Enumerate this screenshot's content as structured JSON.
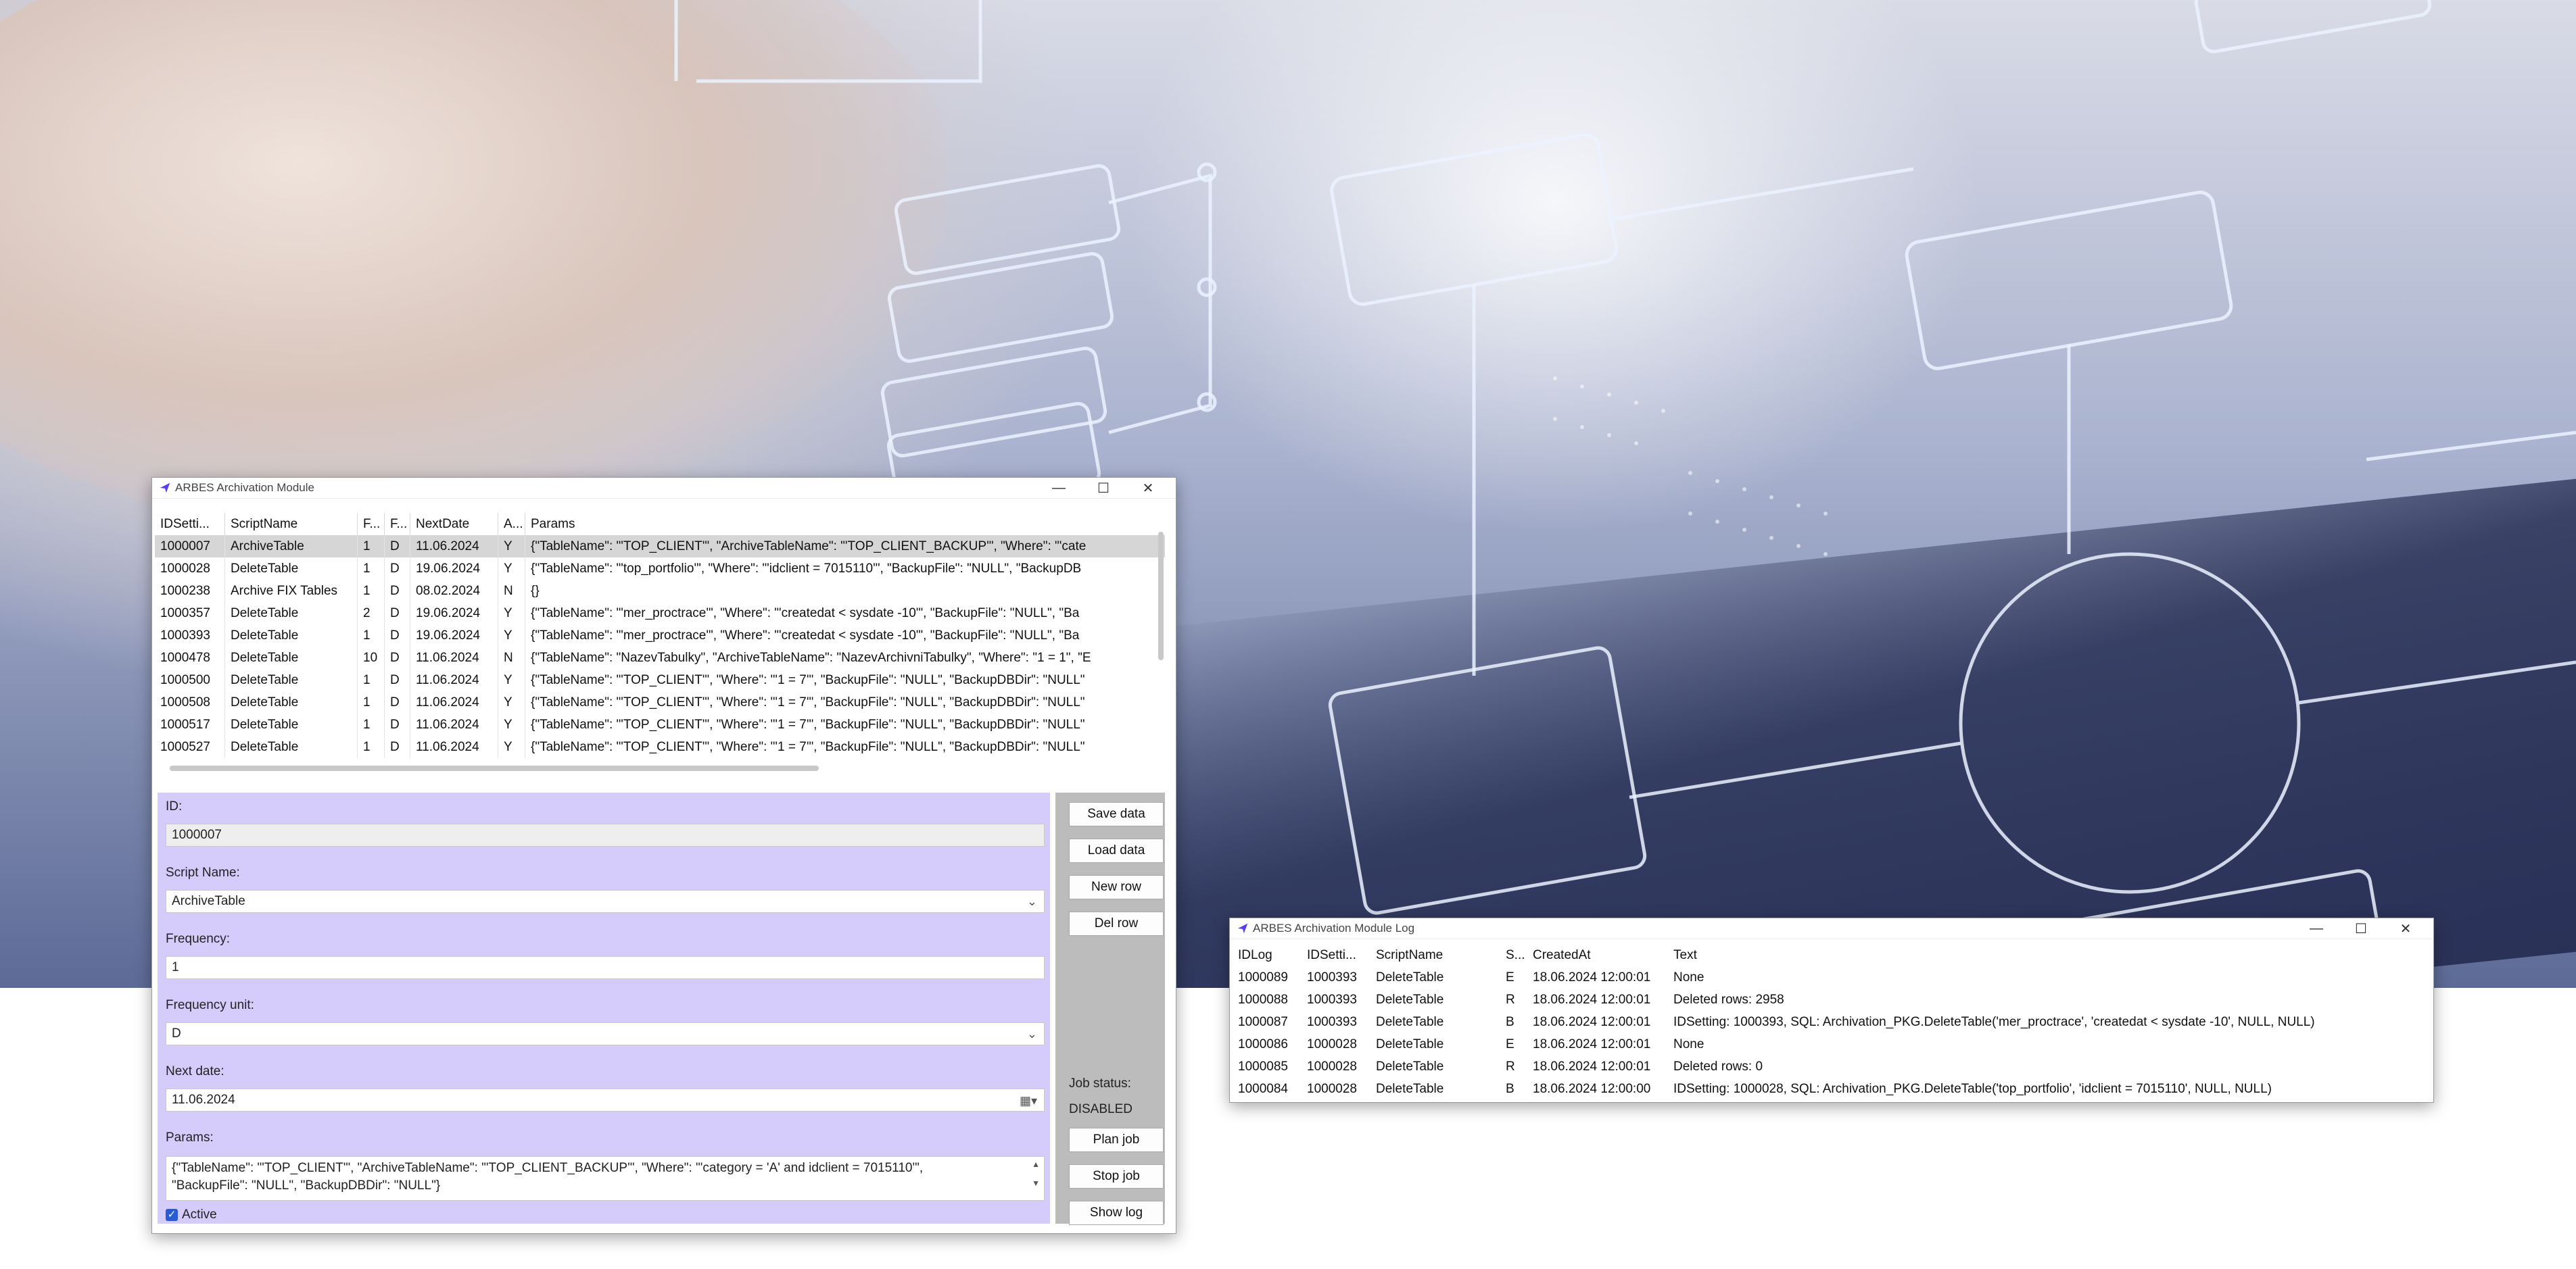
{
  "main_window": {
    "title": "ARBES Archivation Module",
    "controls": {
      "minimize": "—",
      "maximize": "☐",
      "close": "✕"
    },
    "grid": {
      "columns": [
        "IDSetti...",
        "ScriptName",
        "F...",
        "F...",
        "NextDate",
        "A...",
        "Params"
      ],
      "rows": [
        [
          "1000007",
          "ArchiveTable",
          "1",
          "D",
          "11.06.2024",
          "Y",
          "{\"TableName\": \"'TOP_CLIENT'\", \"ArchiveTableName\": \"'TOP_CLIENT_BACKUP'\", \"Where\": \"'cate"
        ],
        [
          "1000028",
          "DeleteTable",
          "1",
          "D",
          "19.06.2024",
          "Y",
          "{\"TableName\": \"'top_portfolio'\", \"Where\": \"'idclient = 7015110'\", \"BackupFile\": \"NULL\", \"BackupDB"
        ],
        [
          "1000238",
          "Archive FIX Tables",
          "1",
          "D",
          "08.02.2024",
          "N",
          "{}"
        ],
        [
          "1000357",
          "DeleteTable",
          "2",
          "D",
          "19.06.2024",
          "Y",
          "{\"TableName\": \"'mer_proctrace'\", \"Where\": \"'createdat < sysdate  -10'\", \"BackupFile\": \"NULL\", \"Ba"
        ],
        [
          "1000393",
          "DeleteTable",
          "1",
          "D",
          "19.06.2024",
          "Y",
          "{\"TableName\": \"'mer_proctrace'\", \"Where\": \"'createdat < sysdate  -10'\", \"BackupFile\": \"NULL\", \"Ba"
        ],
        [
          "1000478",
          "DeleteTable",
          "10",
          "D",
          "11.06.2024",
          "N",
          "{\"TableName\": \"NazevTabulky\", \"ArchiveTableName\": \"NazevArchivniTabulky\", \"Where\": \"1 = 1\", \"E"
        ],
        [
          "1000500",
          "DeleteTable",
          "1",
          "D",
          "11.06.2024",
          "Y",
          "{\"TableName\": \"'TOP_CLIENT'\", \"Where\": \"'1 = 7'\", \"BackupFile\": \"NULL\", \"BackupDBDir\": \"NULL\""
        ],
        [
          "1000508",
          "DeleteTable",
          "1",
          "D",
          "11.06.2024",
          "Y",
          "{\"TableName\": \"'TOP_CLIENT'\", \"Where\": \"'1 = 7'\", \"BackupFile\": \"NULL\", \"BackupDBDir\": \"NULL\""
        ],
        [
          "1000517",
          "DeleteTable",
          "1",
          "D",
          "11.06.2024",
          "Y",
          "{\"TableName\": \"'TOP_CLIENT'\", \"Where\": \"'1 = 7'\", \"BackupFile\": \"NULL\", \"BackupDBDir\": \"NULL\""
        ],
        [
          "1000527",
          "DeleteTable",
          "1",
          "D",
          "11.06.2024",
          "Y",
          "{\"TableName\": \"'TOP_CLIENT'\", \"Where\": \"'1 = 7'\", \"BackupFile\": \"NULL\", \"BackupDBDir\": \"NULL\""
        ]
      ]
    },
    "form": {
      "id_label": "ID:",
      "id_value": "1000007",
      "script_label": "Script Name:",
      "script_value": "ArchiveTable",
      "frequency_label": "Frequency:",
      "frequency_value": "1",
      "freq_unit_label": "Frequency unit:",
      "freq_unit_value": "D",
      "next_date_label": "Next date:",
      "next_date_value": "11.06.2024",
      "params_label": "Params:",
      "params_line1": "{\"TableName\": \"'TOP_CLIENT'\", \"ArchiveTableName\": \"'TOP_CLIENT_BACKUP'\", \"Where\": \"'category = 'A'  and idclient = 7015110'\",",
      "params_line2": "\"BackupFile\": \"NULL\", \"BackupDBDir\": \"NULL\"}",
      "active_label": "Active",
      "active_checked": true
    },
    "buttons": {
      "save": "Save data",
      "load": "Load data",
      "new_row": "New row",
      "del_row": "Del row",
      "plan_job": "Plan job",
      "stop_job": "Stop job",
      "show_log": "Show log"
    },
    "job_status_label": "Job status:",
    "job_status_value": "DISABLED"
  },
  "log_window": {
    "title": "ARBES Archivation Module Log",
    "controls": {
      "minimize": "—",
      "maximize": "☐",
      "close": "✕"
    },
    "grid": {
      "columns": [
        "IDLog",
        "IDSetti...",
        "ScriptName",
        "S...",
        "CreatedAt",
        "Text"
      ],
      "rows": [
        [
          "1000089",
          "1000393",
          "DeleteTable",
          "E",
          "18.06.2024 12:00:01",
          "None"
        ],
        [
          "1000088",
          "1000393",
          "DeleteTable",
          "R",
          "18.06.2024 12:00:01",
          "Deleted rows: 2958"
        ],
        [
          "1000087",
          "1000393",
          "DeleteTable",
          "B",
          "18.06.2024 12:00:01",
          "IDSetting: 1000393, SQL: Archivation_PKG.DeleteTable('mer_proctrace', 'createdat < sysdate  -10', NULL, NULL)"
        ],
        [
          "1000086",
          "1000028",
          "DeleteTable",
          "E",
          "18.06.2024 12:00:01",
          "None"
        ],
        [
          "1000085",
          "1000028",
          "DeleteTable",
          "R",
          "18.06.2024 12:00:01",
          "Deleted rows: 0"
        ],
        [
          "1000084",
          "1000028",
          "DeleteTable",
          "B",
          "18.06.2024 12:00:00",
          "IDSetting: 1000028, SQL: Archivation_PKG.DeleteTable('top_portfolio', 'idclient = 7015110', NULL, NULL)"
        ]
      ]
    }
  },
  "colors": {
    "form_bg": "#d5ccfb",
    "side_panel_bg": "#bcbcbc",
    "selected_row": "#d6d6d6",
    "app_icon": "#5b3cf2"
  }
}
